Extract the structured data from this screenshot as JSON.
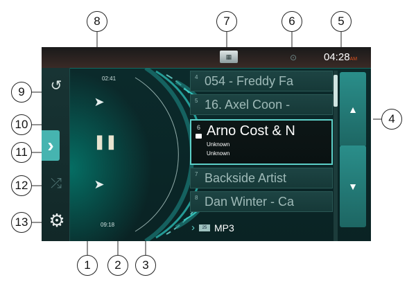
{
  "status": {
    "clock_time": "04:28",
    "clock_ampm": "AM"
  },
  "player": {
    "elapsed": "02:41",
    "total": "09:18"
  },
  "playlist": {
    "items": [
      {
        "num": "4",
        "title": "054 - Freddy Fa"
      },
      {
        "num": "5",
        "title": "16. Axel Coon -"
      },
      {
        "num": "6",
        "title": "Arno Cost & N",
        "line2": "Unknown",
        "line3": "Unknown"
      },
      {
        "num": "7",
        "title": "Backside Artist"
      },
      {
        "num": "8",
        "title": "Dan Winter - Ca"
      }
    ]
  },
  "folder": {
    "badge": "25",
    "label": "MP3"
  },
  "callouts": [
    "1",
    "2",
    "3",
    "4",
    "5",
    "6",
    "7",
    "8",
    "9",
    "10",
    "11",
    "12",
    "13"
  ],
  "icons": {
    "repeat": "repeat-icon",
    "expand": "chevron-right-icon",
    "shuffle": "shuffle-icon",
    "settings": "gear-icon",
    "next": "next-track-icon",
    "prev": "prev-track-icon",
    "pause": "pause-icon",
    "tuner": "source-icon",
    "bluetooth": "bluetooth-icon"
  },
  "colors": {
    "accent": "#5dd0c8",
    "ampm": "#e0531e",
    "background": "#0b2b2c"
  }
}
